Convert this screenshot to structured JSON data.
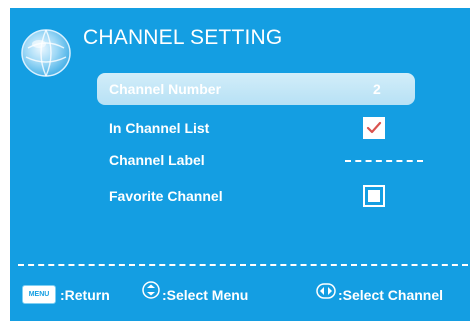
{
  "screen": {
    "title": "CHANNEL SETTING",
    "background_color": "#149ee2",
    "icon": "globe-icon"
  },
  "menu": {
    "items": [
      {
        "label": "Channel Number",
        "value": "2",
        "selected": true
      },
      {
        "label": "In Channel List",
        "control": "checkbox",
        "checked": true
      },
      {
        "label": "Channel Label",
        "control": "text",
        "value": "------"
      },
      {
        "label": "Favorite Channel",
        "control": "checkbox",
        "checked": false
      }
    ]
  },
  "footer": {
    "menu_key": "MENU",
    "return_text": ":Return",
    "select_menu_text": ":Select Menu",
    "select_channel_text": ":Select Channel",
    "icons": [
      "menu-key-icon",
      "up-down-arrow-icon",
      "left-right-arrow-icon"
    ]
  }
}
